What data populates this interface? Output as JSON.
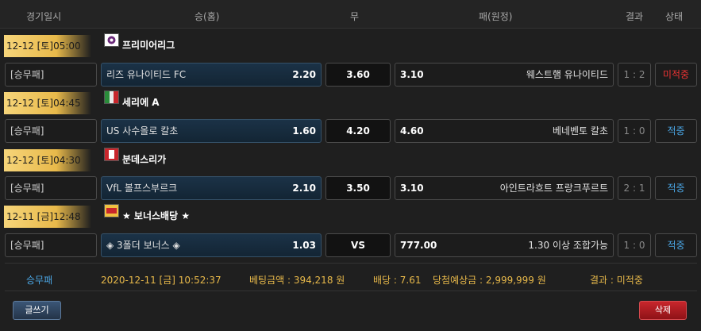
{
  "header": {
    "date": "경기일시",
    "home": "승(홈)",
    "draw": "무",
    "away": "패(원정)",
    "result": "결과",
    "status": "상태"
  },
  "games": [
    {
      "datetime": "12-12 [토]05:00",
      "league": "프리미어리그",
      "flag_icon": "england-flag-icon",
      "type": "[승무패]",
      "home_team": "리즈 유나이티드 FC",
      "home_odd": "2.20",
      "draw_odd": "3.60",
      "away_odd": "3.10",
      "away_team": "웨스트햄 유나이티드",
      "result": "1 : 2",
      "status": "미적중",
      "status_color": "#e33333"
    },
    {
      "datetime": "12-12 [토]04:45",
      "league": "세리에 A",
      "flag_icon": "italy-flag-icon",
      "type": "[승무패]",
      "home_team": "US 사수올로 칼초",
      "home_odd": "1.60",
      "draw_odd": "4.20",
      "away_odd": "4.60",
      "away_team": "베네벤토 칼초",
      "result": "1 : 0",
      "status": "적중",
      "status_color": "#4aa5e3"
    },
    {
      "datetime": "12-12 [토]04:30",
      "league": "분데스리가",
      "flag_icon": "germany-flag-icon",
      "type": "[승무패]",
      "home_team": "VfL 볼프스부르크",
      "home_odd": "2.10",
      "draw_odd": "3.50",
      "away_odd": "3.10",
      "away_team": "아인트라흐트 프랑크푸르트",
      "result": "2 : 1",
      "status": "적중",
      "status_color": "#4aa5e3"
    },
    {
      "datetime": "12-11 [금]12:48",
      "league": "★ 보너스배당 ★",
      "flag_icon": "bonus-icon",
      "type": "[승무패]",
      "home_team": "◈ 3폴더 보너스 ◈",
      "home_odd": "1.03",
      "draw_odd": "VS",
      "away_odd": "777.00",
      "away_team": "1.30 이상 조합가능",
      "result": "1 : 0",
      "status": "적중",
      "status_color": "#4aa5e3"
    }
  ],
  "summary": {
    "type": "승무패",
    "datetime": "2020-12-11 [금] 10:52:37",
    "bet_amount": "베팅금액 : 394,218 원",
    "odds": "배당 : 7.61",
    "expected": "당첨예상금 : 2,999,999 원",
    "result": "결과 : 미적중"
  },
  "buttons": {
    "write": "글쓰기",
    "delete": "삭제"
  }
}
